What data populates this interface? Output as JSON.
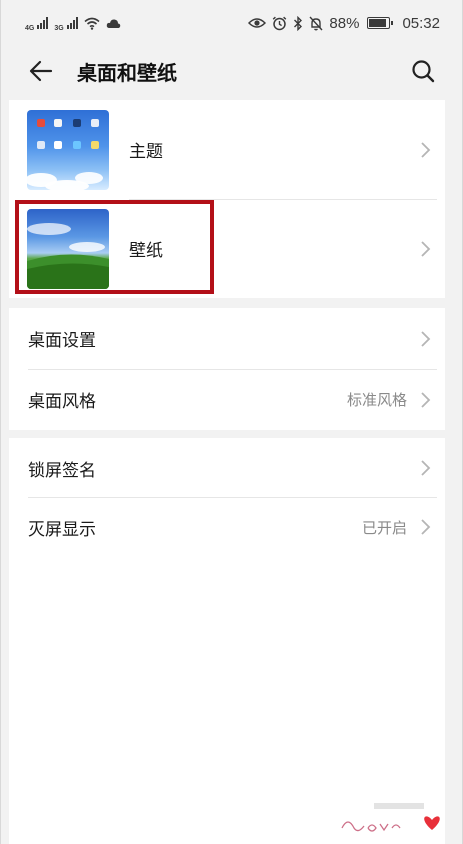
{
  "status_bar": {
    "network_1": "4G",
    "network_2": "3G",
    "battery": "88%",
    "time": "05:32",
    "icons": [
      "signal-icon",
      "wifi-icon",
      "cloud-icon",
      "eye-icon",
      "alarm-icon",
      "bluetooth-icon",
      "mute-icon",
      "battery-icon"
    ]
  },
  "header": {
    "title": "桌面和壁纸",
    "back_icon": "back-arrow-icon",
    "search_icon": "search-icon"
  },
  "section1": {
    "items": [
      {
        "label": "主题",
        "thumbnail": "theme-thumbnail"
      },
      {
        "label": "壁纸",
        "thumbnail": "wallpaper-thumbnail",
        "highlighted": true
      }
    ]
  },
  "section2": {
    "items": [
      {
        "label": "桌面设置",
        "value": ""
      },
      {
        "label": "桌面风格",
        "value": "标准风格"
      }
    ]
  },
  "section3": {
    "items": [
      {
        "label": "锁屏签名",
        "value": ""
      },
      {
        "label": "灭屏显示",
        "value": "已开启"
      }
    ]
  },
  "colors": {
    "background": "#f2f2f2",
    "card": "#ffffff",
    "highlight": "#b30f18",
    "secondary_text": "#8a8a8a"
  }
}
